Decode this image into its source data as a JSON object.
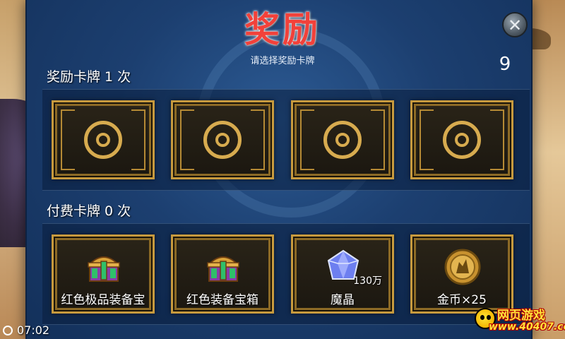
{
  "header": {
    "title": "奖励",
    "subtitle": "请选择奖励卡牌",
    "close_icon": "close-icon",
    "close_symbol": "✕",
    "counter": "9"
  },
  "reward_section": {
    "label": "奖励卡牌",
    "count": "1",
    "unit": "次",
    "cards": [
      {
        "state": "face-down"
      },
      {
        "state": "face-down"
      },
      {
        "state": "face-down"
      },
      {
        "state": "face-down"
      }
    ]
  },
  "paid_section": {
    "label": "付费卡牌",
    "count": "0",
    "unit": "次",
    "cards": [
      {
        "icon": "treasure-chest-icon",
        "label": "红色极品装备宝",
        "qty": ""
      },
      {
        "icon": "treasure-chest-icon",
        "label": "红色装备宝箱",
        "qty": ""
      },
      {
        "icon": "crystal-icon",
        "label": "魔晶",
        "qty": "130万"
      },
      {
        "icon": "gold-coin-icon",
        "label": "金币×25",
        "qty": ""
      }
    ]
  },
  "status": {
    "time": "07:02"
  },
  "watermark": {
    "line1": "网页游戏",
    "line2": "www.40407.com"
  },
  "colors": {
    "title": "#f2413a",
    "panel": "#1c3f70",
    "card_border": "#c79a3e"
  }
}
